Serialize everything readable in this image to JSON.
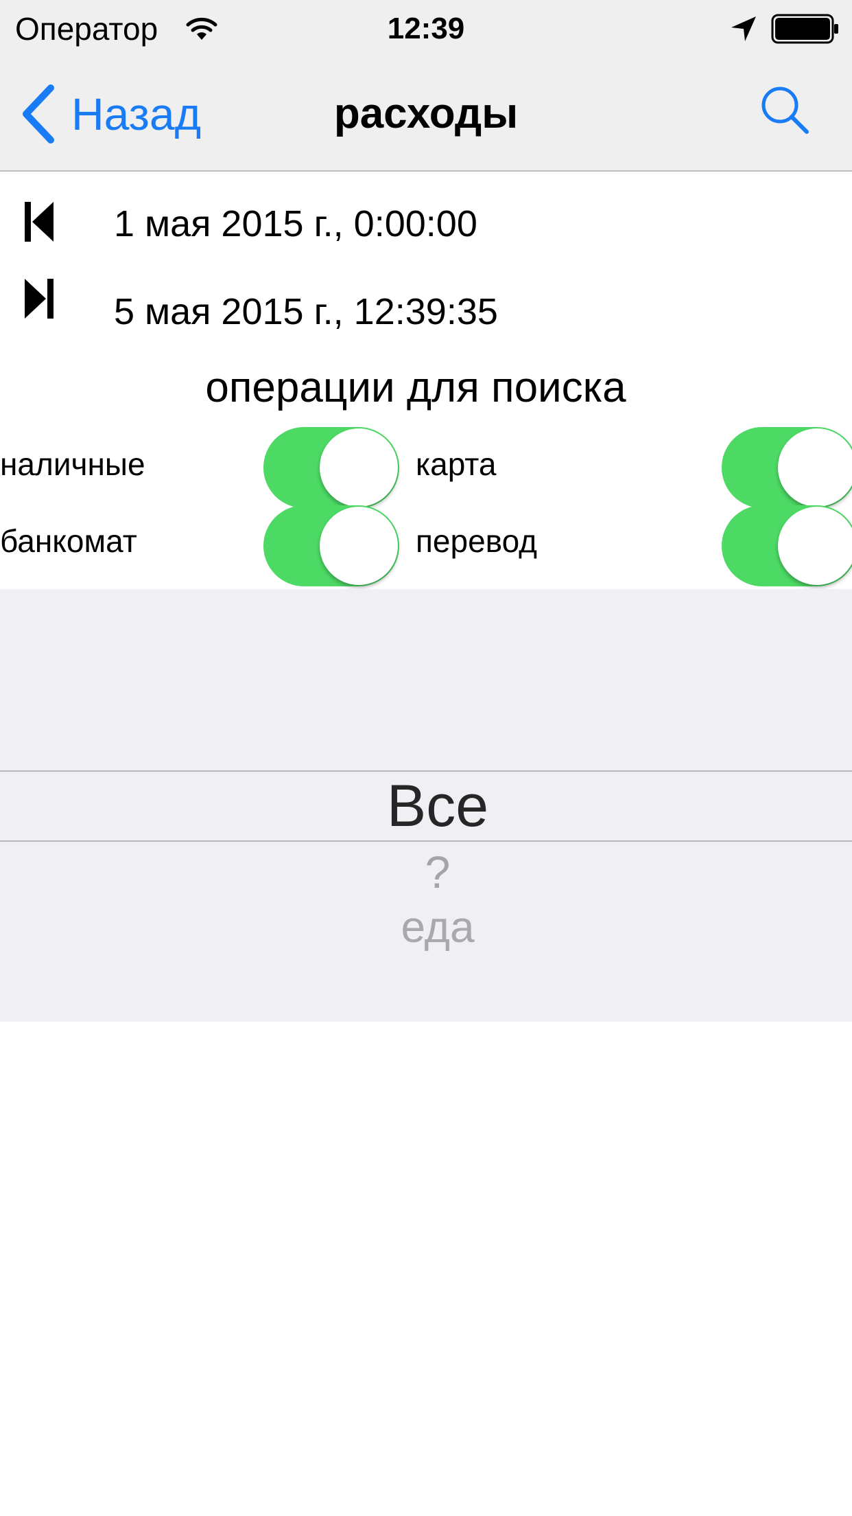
{
  "status_bar": {
    "carrier": "Оператор",
    "time": "12:39"
  },
  "nav_bar": {
    "back_label": "Назад",
    "title": "расходы",
    "accent_color": "#1a7cf5"
  },
  "date_range": {
    "start": "1 мая 2015 г., 0:00:00",
    "end": "5 мая 2015 г., 12:39:35"
  },
  "operations": {
    "title": "операции для поиска",
    "switch_color": "#4cd964",
    "items": [
      {
        "label": "наличные",
        "on": true
      },
      {
        "label": "карта",
        "on": true
      },
      {
        "label": "банкомат",
        "on": true
      },
      {
        "label": "перевод",
        "on": true
      }
    ]
  },
  "category_picker": {
    "selected": "Все",
    "options": [
      "Все",
      "?",
      "еда"
    ]
  }
}
